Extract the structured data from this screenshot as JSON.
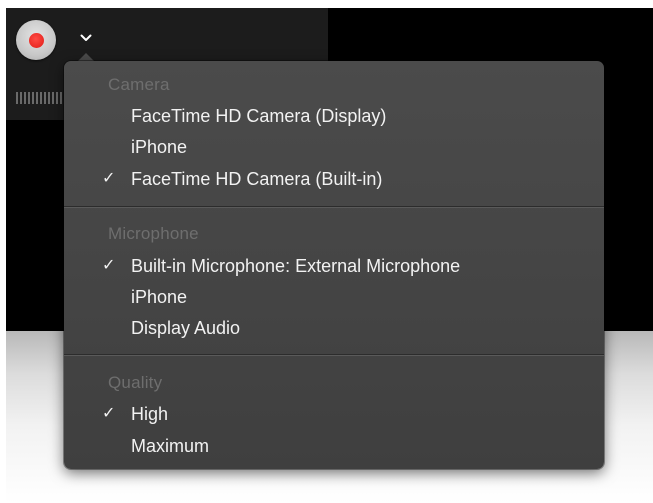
{
  "record_control": {
    "record_icon": "record-dot",
    "chevron_icon": "chevron-down"
  },
  "menu": {
    "sections": [
      {
        "header": "Camera",
        "items": [
          {
            "label": "FaceTime HD Camera (Display)",
            "checked": false
          },
          {
            "label": "iPhone",
            "checked": false
          },
          {
            "label": "FaceTime HD Camera (Built-in)",
            "checked": true,
            "check_mark": "✓"
          }
        ]
      },
      {
        "header": "Microphone",
        "items": [
          {
            "label": "Built-in Microphone: External Microphone",
            "checked": true,
            "check_mark": "✓"
          },
          {
            "label": "iPhone",
            "checked": false
          },
          {
            "label": "Display Audio",
            "checked": false
          }
        ]
      },
      {
        "header": "Quality",
        "items": [
          {
            "label": "High",
            "checked": true,
            "check_mark": "✓"
          },
          {
            "label": "Maximum",
            "checked": false
          }
        ]
      }
    ]
  },
  "colors": {
    "record_red": "#ea2a24",
    "menu_background": "#464646",
    "menu_text": "#f2f2f2",
    "section_header_text": "#6e6e6e"
  }
}
